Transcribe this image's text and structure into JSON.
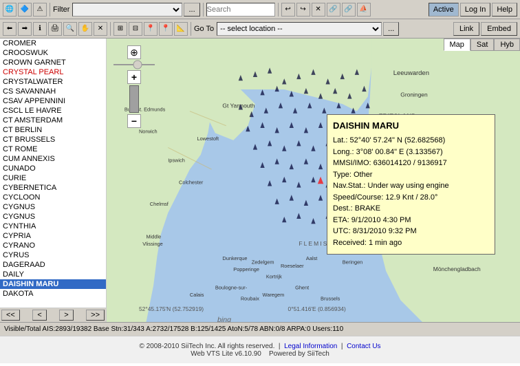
{
  "toolbar1": {
    "filter_label": "Filter",
    "filter_placeholder": "",
    "search_placeholder": "Search",
    "search_value": "",
    "btn_active": "Active",
    "btn_login": "Log In",
    "btn_help": "Help",
    "btn_dotdotdot": "..."
  },
  "toolbar2": {
    "goto_label": "Go To",
    "location_placeholder": "-- select location --",
    "btn_dotdotdot": "...",
    "btn_link": "Link",
    "btn_embed": "Embed"
  },
  "sidebar": {
    "items": [
      {
        "label": "CROMER",
        "red": false,
        "selected": false
      },
      {
        "label": "CROOSWUK",
        "red": false,
        "selected": false
      },
      {
        "label": "CROWN GARNET",
        "red": false,
        "selected": false
      },
      {
        "label": "CRYSTAL PEARL",
        "red": true,
        "selected": false
      },
      {
        "label": "CRYSTALWATER",
        "red": false,
        "selected": false
      },
      {
        "label": "CS SAVANNAH",
        "red": false,
        "selected": false
      },
      {
        "label": "CSAV APPENNINI",
        "red": false,
        "selected": false
      },
      {
        "label": "CSCL LE HAVRE",
        "red": false,
        "selected": false
      },
      {
        "label": "CT AMSTERDAM",
        "red": false,
        "selected": false
      },
      {
        "label": "CT BERLIN",
        "red": false,
        "selected": false
      },
      {
        "label": "CT BRUSSELS",
        "red": false,
        "selected": false
      },
      {
        "label": "CT ROME",
        "red": false,
        "selected": false
      },
      {
        "label": "CUM ANNEXIS",
        "red": false,
        "selected": false
      },
      {
        "label": "CUNADO",
        "red": false,
        "selected": false
      },
      {
        "label": "CURIE",
        "red": false,
        "selected": false
      },
      {
        "label": "CYBERNETICA",
        "red": false,
        "selected": false
      },
      {
        "label": "CYCLOON",
        "red": false,
        "selected": false
      },
      {
        "label": "CYGNUS",
        "red": false,
        "selected": false
      },
      {
        "label": "CYGNUS",
        "red": false,
        "selected": false
      },
      {
        "label": "CYNTHIA",
        "red": false,
        "selected": false
      },
      {
        "label": "CYPRIA",
        "red": false,
        "selected": false
      },
      {
        "label": "CYRANO",
        "red": false,
        "selected": false
      },
      {
        "label": "CYRUS",
        "red": false,
        "selected": false
      },
      {
        "label": "DAGERAAD",
        "red": false,
        "selected": false
      },
      {
        "label": "DAILY",
        "red": false,
        "selected": false
      },
      {
        "label": "DAISHIN MARU",
        "red": false,
        "selected": true
      },
      {
        "label": "DAKOTA",
        "red": false,
        "selected": false
      }
    ],
    "nav": {
      "first": "<<",
      "prev": "<",
      "next": ">",
      "last": ">>"
    }
  },
  "vessel": {
    "name": "DAISHIN MARU",
    "lat": "Lat.: 52°40' 57.24\" N (52.682568)",
    "long": "Long.: 3°08' 00.84\" E (3.133567)",
    "mmsi": "MMSI/IMO: 636014120 / 9136917",
    "type": "Type: Other",
    "navstat": "Nav.Stat.: Under way using engine",
    "speed": "Speed/Course: 12.9 Knt / 28.0°",
    "dest": "Dest.: BRAKE",
    "eta": "ETA: 9/1/2010 4:30 PM",
    "utc": "UTC: 8/31/2010 9:32 PM",
    "received": "Received: 1 min ago"
  },
  "statusbar": {
    "text": "Visible/Total AIS:2893/19382  Base Stn:31/343  A:2732/17528  B:125/1425  AtoN:5/78  ABN:0/8  ARPA:0  Users:110"
  },
  "bottombar": {
    "copyright": "© 2008-2010 SiiTech Inc. All rights reserved.",
    "legal": "Legal Information",
    "contact": "Contact Us",
    "powered": "Web VTS Lite v6.10.90",
    "powered2": "Powered by SiiTech"
  },
  "map": {
    "tabs": [
      "Map",
      "Sat",
      "Hyb"
    ],
    "active_tab": "Map"
  }
}
